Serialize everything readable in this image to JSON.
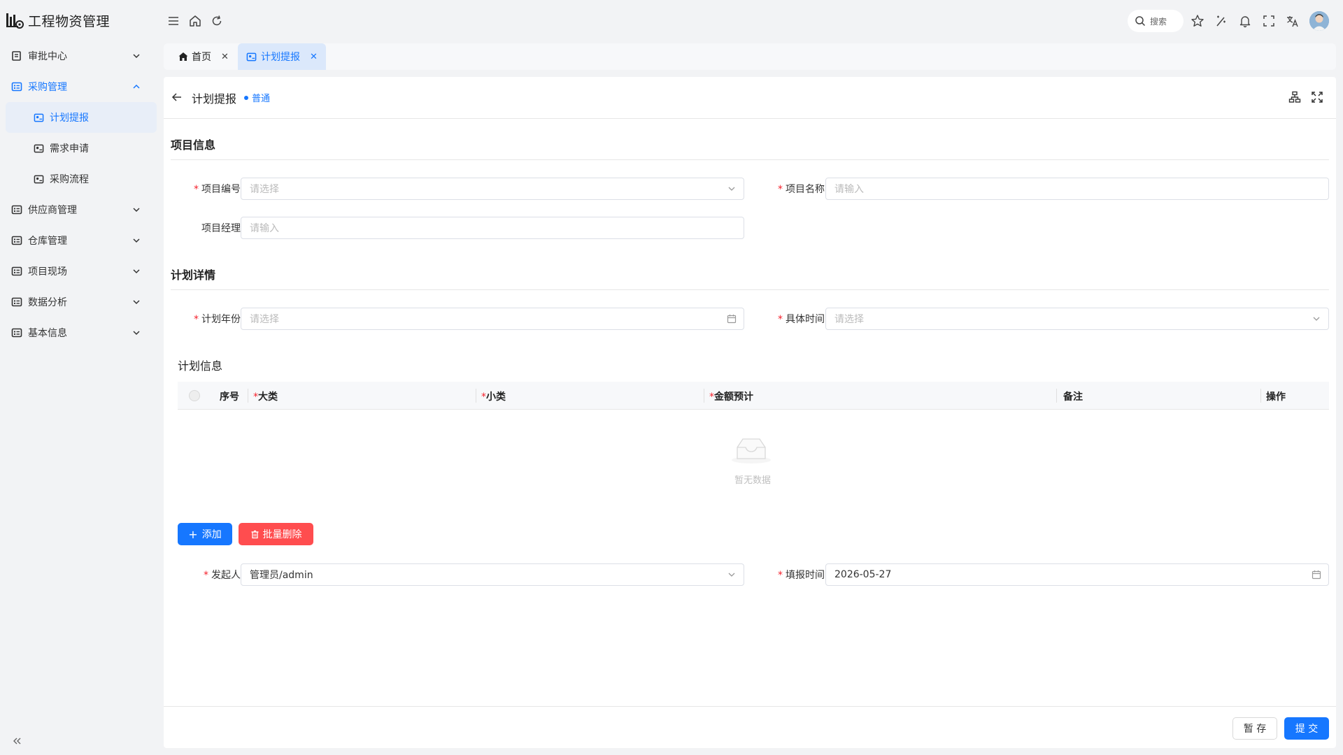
{
  "app": {
    "title": "工程物资管理"
  },
  "sidebar": {
    "items": [
      {
        "label": "审批中心"
      },
      {
        "label": "采购管理"
      },
      {
        "label": "供应商管理"
      },
      {
        "label": "仓库管理"
      },
      {
        "label": "项目现场"
      },
      {
        "label": "数据分析"
      },
      {
        "label": "基本信息"
      }
    ],
    "sub_items": [
      {
        "label": "计划提报"
      },
      {
        "label": "需求申请"
      },
      {
        "label": "采购流程"
      }
    ]
  },
  "header": {
    "search_label": "搜索"
  },
  "tabs": [
    {
      "label": "首页"
    },
    {
      "label": "计划提报"
    }
  ],
  "page": {
    "title": "计划提报",
    "badge": "普通"
  },
  "sections": {
    "project": "项目信息",
    "plan": "计划详情",
    "plan_info": "计划信息"
  },
  "fields": {
    "project_no": {
      "label": "项目编号",
      "placeholder": "请选择"
    },
    "project_name": {
      "label": "项目名称",
      "placeholder": "请输入"
    },
    "project_manager": {
      "label": "项目经理",
      "placeholder": "请输入"
    },
    "plan_year": {
      "label": "计划年份",
      "placeholder": "请选择"
    },
    "specific_time": {
      "label": "具体时间",
      "placeholder": "请选择"
    },
    "initiator": {
      "label": "发起人",
      "value": "管理员/admin"
    },
    "fill_time": {
      "label": "填报时间",
      "value": "2026-05-27"
    }
  },
  "table": {
    "columns": [
      "序号",
      "大类",
      "小类",
      "金额预计",
      "备注",
      "操作"
    ],
    "empty_text": "暂无数据"
  },
  "buttons": {
    "add": "添加",
    "batch_delete": "批量删除",
    "save_draft": "暂 存",
    "submit": "提 交"
  },
  "colors": {
    "accent": "#1677ff",
    "danger": "#ff4d4f",
    "required": "#f5222d"
  }
}
